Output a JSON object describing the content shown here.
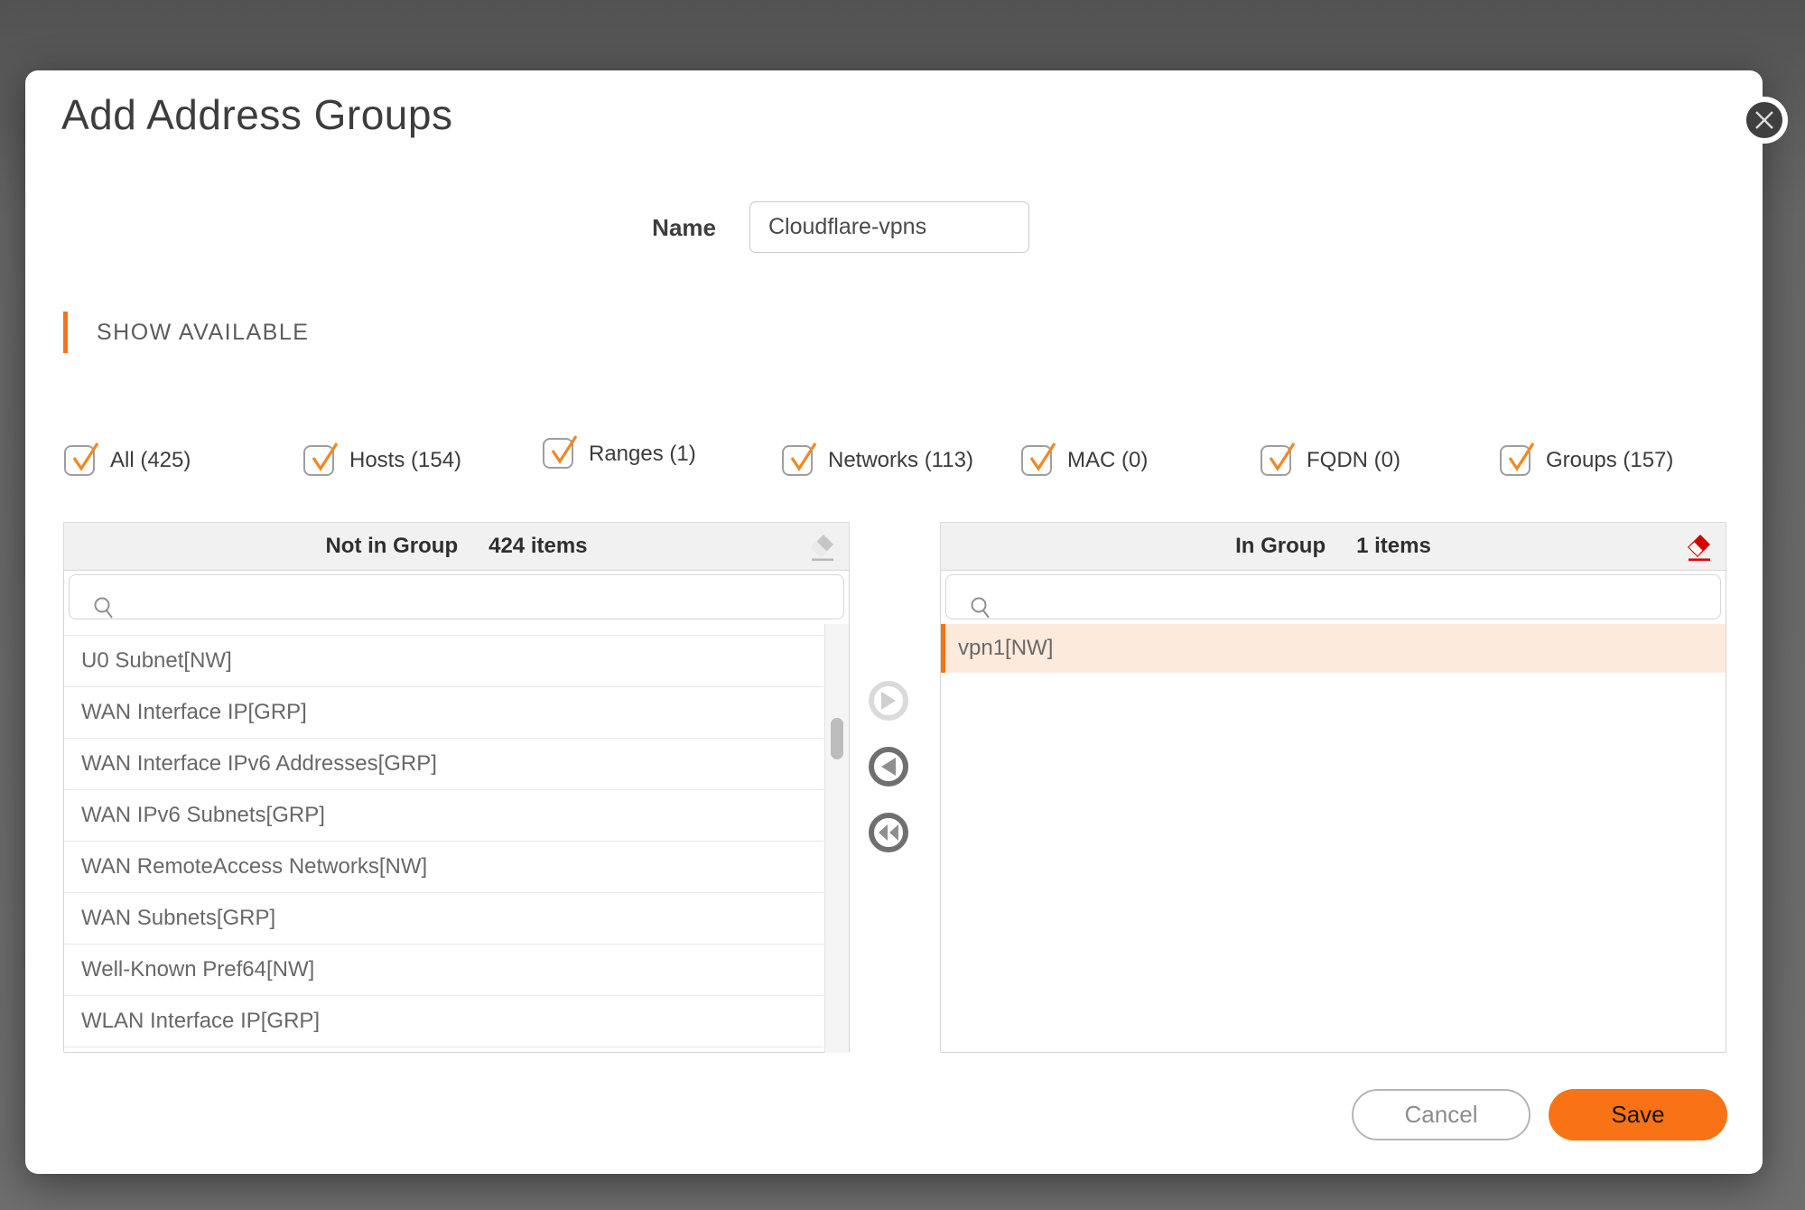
{
  "colors": {
    "accent": "#F97316",
    "check": "#F5861F",
    "eraser-gray": "#C6C6C6",
    "eraser-red": "#D40000"
  },
  "dialog": {
    "title": "Add Address Groups",
    "close_icon": "close-icon"
  },
  "name_field": {
    "label": "Name",
    "value": "Cloudflare-vpns"
  },
  "section": {
    "title": "SHOW AVAILABLE"
  },
  "filters": [
    {
      "label": "All (425)",
      "checked": true
    },
    {
      "label": "Hosts (154)",
      "checked": true
    },
    {
      "label": "Ranges (1)",
      "checked": true
    },
    {
      "label": "Networks (113)",
      "checked": true
    },
    {
      "label": "MAC (0)",
      "checked": true
    },
    {
      "label": "FQDN (0)",
      "checked": true
    },
    {
      "label": "Groups (157)",
      "checked": true
    }
  ],
  "left_panel": {
    "title": "Not in Group",
    "count": "424 items",
    "search_placeholder": "",
    "items": [
      "U0 Subnet[NW]",
      "WAN Interface IP[GRP]",
      "WAN Interface IPv6 Addresses[GRP]",
      "WAN IPv6 Subnets[GRP]",
      "WAN RemoteAccess Networks[NW]",
      "WAN Subnets[GRP]",
      "Well-Known Pref64[NW]",
      "WLAN Interface IP[GRP]"
    ]
  },
  "right_panel": {
    "title": "In Group",
    "count": "1 items",
    "search_placeholder": "",
    "items": [
      "vpn1[NW]"
    ]
  },
  "footer": {
    "cancel_label": "Cancel",
    "save_label": "Save"
  }
}
